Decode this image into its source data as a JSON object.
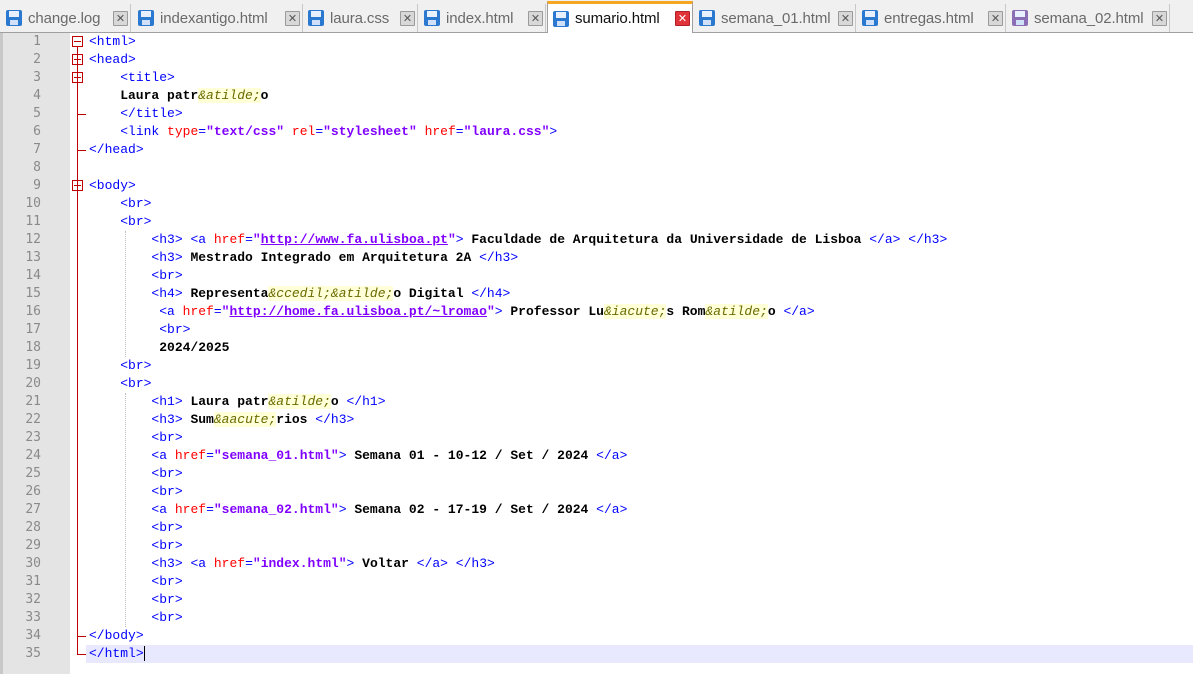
{
  "tabs": [
    {
      "label": "change.log",
      "active": false,
      "dirty": false
    },
    {
      "label": "indexantigo.html",
      "active": false,
      "dirty": false
    },
    {
      "label": "laura.css",
      "active": false,
      "dirty": false
    },
    {
      "label": "index.html",
      "active": false,
      "dirty": false
    },
    {
      "label": "sumario.html",
      "active": true,
      "dirty": false
    },
    {
      "label": "semana_01.html",
      "active": false,
      "dirty": false
    },
    {
      "label": "entregas.html",
      "active": false,
      "dirty": false
    },
    {
      "label": "semana_02.html",
      "active": false,
      "dirty": true
    }
  ],
  "colors": {
    "tag": "#0000ff",
    "attribute": "#ff0000",
    "value": "#8000ff",
    "entity": "#6a6a00",
    "fold_marker": "#c00000",
    "active_tab_accent": "#f5a623",
    "current_line": "#e8e8ff"
  },
  "editor": {
    "current_line": 35,
    "lines": [
      {
        "n": "1",
        "code": "<html>"
      },
      {
        "n": "2",
        "code": "<head>"
      },
      {
        "n": "3",
        "code": "    <title>"
      },
      {
        "n": "4",
        "code": "    Laura patr&atilde;o"
      },
      {
        "n": "5",
        "code": "    </title>"
      },
      {
        "n": "6",
        "code": "    <link type=\"text/css\" rel=\"stylesheet\" href=\"laura.css\">"
      },
      {
        "n": "7",
        "code": "</head>"
      },
      {
        "n": "8",
        "code": ""
      },
      {
        "n": "9",
        "code": "<body>"
      },
      {
        "n": "10",
        "code": "    <br>"
      },
      {
        "n": "11",
        "code": "    <br>"
      },
      {
        "n": "12",
        "code": "        <h3> <a href=\"http://www.fa.ulisboa.pt\"> Faculdade de Arquitetura da Universidade de Lisboa </a> </h3>"
      },
      {
        "n": "13",
        "code": "        <h3> Mestrado Integrado em Arquitetura 2A </h3>"
      },
      {
        "n": "14",
        "code": "        <br>"
      },
      {
        "n": "15",
        "code": "        <h4> Representa&ccedil;&atilde;o Digital </h4>"
      },
      {
        "n": "16",
        "code": "         <a href=\"http://home.fa.ulisboa.pt/~lromao\"> Professor Lu&iacute;s Rom&atilde;o </a>"
      },
      {
        "n": "17",
        "code": "         <br>"
      },
      {
        "n": "18",
        "code": "         2024/2025"
      },
      {
        "n": "19",
        "code": "    <br>"
      },
      {
        "n": "20",
        "code": "    <br>"
      },
      {
        "n": "21",
        "code": "        <h1> Laura patr&atilde;o </h1>"
      },
      {
        "n": "22",
        "code": "        <h3> Sum&aacute;rios </h3>"
      },
      {
        "n": "23",
        "code": "        <br>"
      },
      {
        "n": "24",
        "code": "        <a href=\"semana_01.html\"> Semana 01 - 10-12 / Set / 2024 </a>"
      },
      {
        "n": "25",
        "code": "        <br>"
      },
      {
        "n": "26",
        "code": "        <br>"
      },
      {
        "n": "27",
        "code": "        <a href=\"semana_02.html\"> Semana 02 - 17-19 / Set / 2024 </a>"
      },
      {
        "n": "28",
        "code": "        <br>"
      },
      {
        "n": "29",
        "code": "        <br>"
      },
      {
        "n": "30",
        "code": "        <h3> <a href=\"index.html\"> Voltar </a> </h3>"
      },
      {
        "n": "31",
        "code": "        <br>"
      },
      {
        "n": "32",
        "code": "        <br>"
      },
      {
        "n": "33",
        "code": "        <br>"
      },
      {
        "n": "34",
        "code": "</body>"
      },
      {
        "n": "35",
        "code": "</html>"
      }
    ]
  }
}
